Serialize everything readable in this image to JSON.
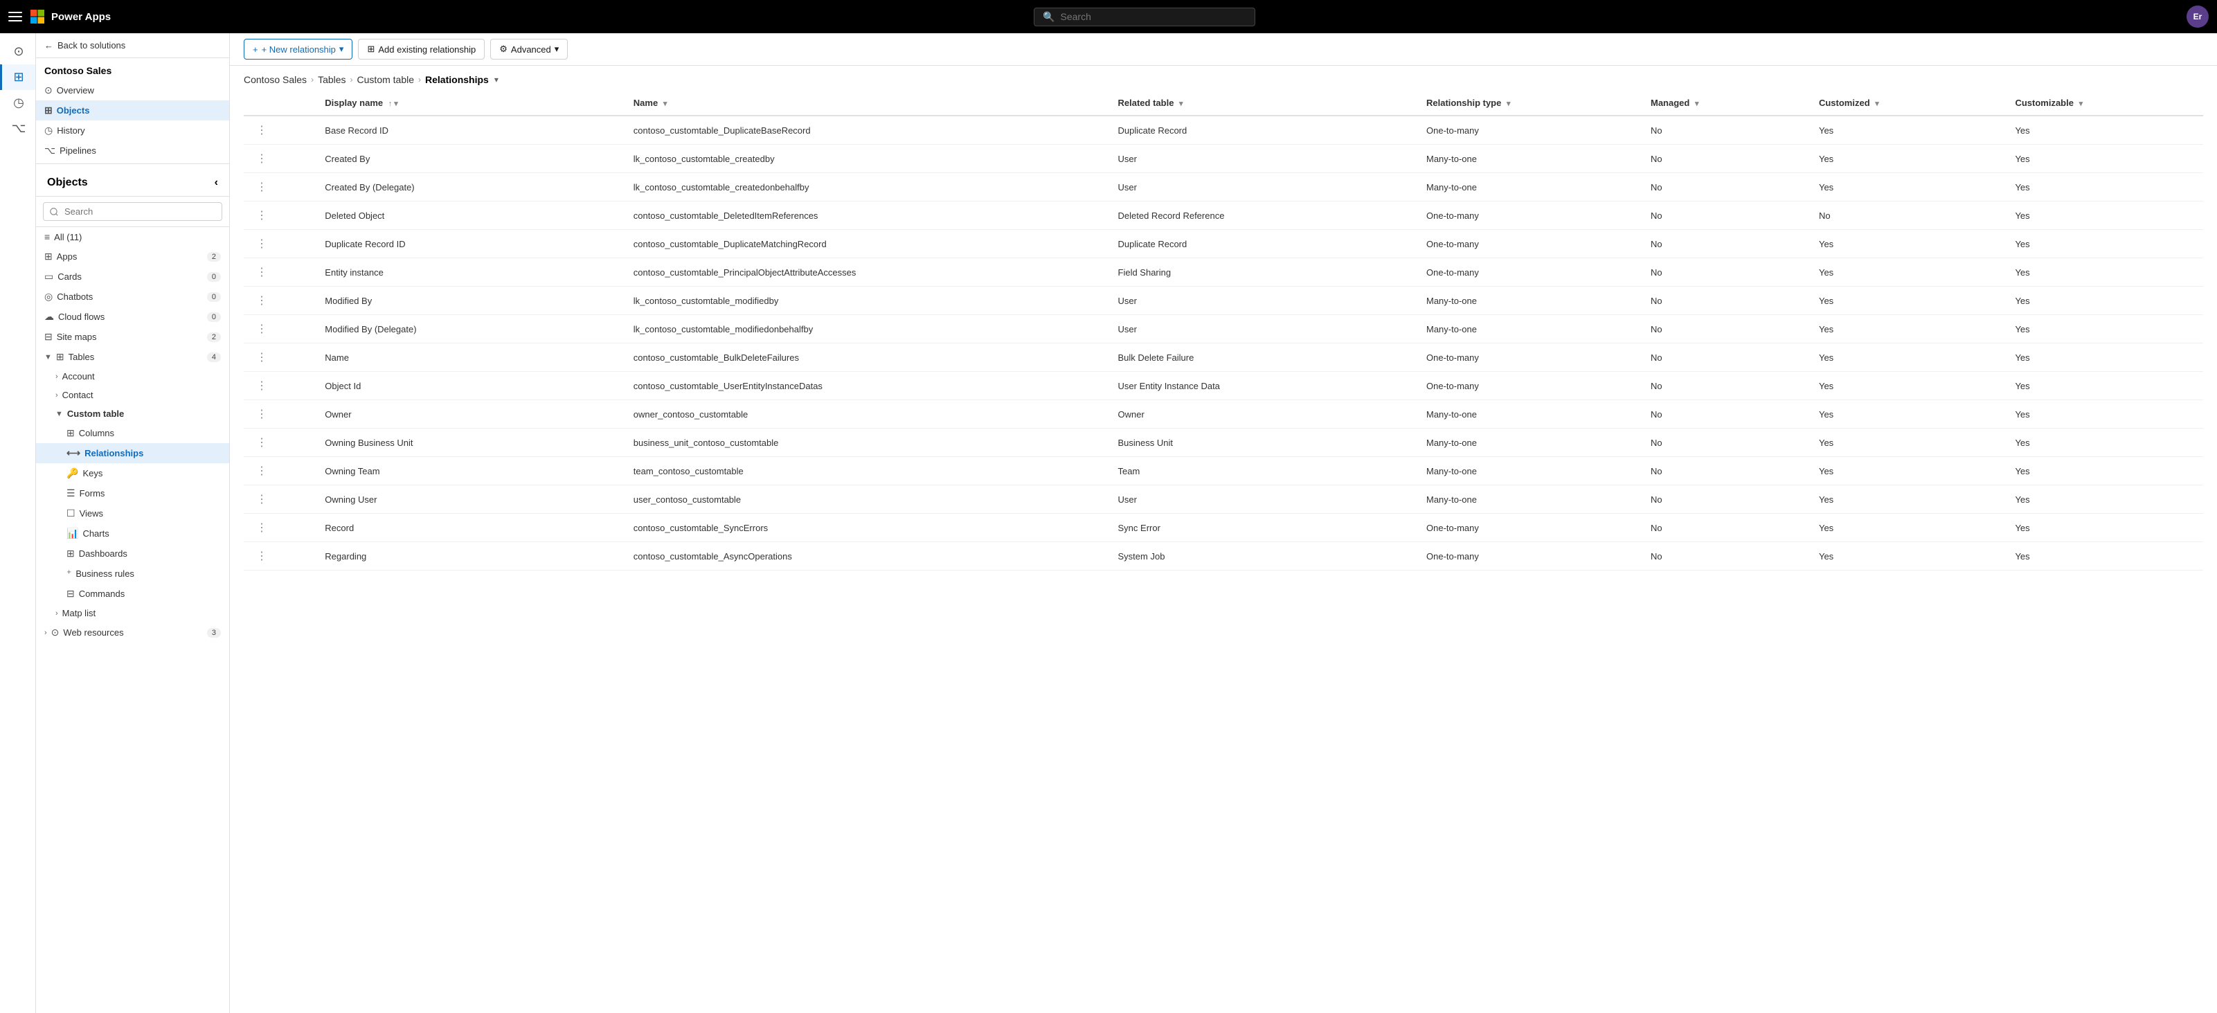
{
  "topbar": {
    "app_name": "Power Apps",
    "search_placeholder": "Search"
  },
  "back_link": "Back to solutions",
  "app_title": "Contoso Sales",
  "objects_header": "Objects",
  "search_placeholder": "Search",
  "left_nav": [
    {
      "id": "overview",
      "icon": "⊙",
      "label": "Overview"
    },
    {
      "id": "objects",
      "icon": "⊞",
      "label": "Objects",
      "active": true
    },
    {
      "id": "history",
      "icon": "◷",
      "label": "History"
    },
    {
      "id": "pipelines",
      "icon": "⌥",
      "label": "Pipelines"
    }
  ],
  "tree": {
    "all_count": 11,
    "items": [
      {
        "id": "all",
        "label": "All (11)",
        "icon": "≡",
        "indent": 0
      },
      {
        "id": "apps",
        "label": "Apps",
        "count": "(2)",
        "icon": "⊞",
        "indent": 0
      },
      {
        "id": "cards",
        "label": "Cards",
        "count": "(0)",
        "icon": "▭",
        "indent": 0
      },
      {
        "id": "chatbots",
        "label": "Chatbots",
        "count": "(0)",
        "icon": "◎",
        "indent": 0
      },
      {
        "id": "cloudflows",
        "label": "Cloud flows",
        "count": "(0)",
        "icon": "☁",
        "indent": 0
      },
      {
        "id": "sitemaps",
        "label": "Site maps",
        "count": "(2)",
        "icon": "⊟",
        "indent": 0
      },
      {
        "id": "tables",
        "label": "Tables",
        "count": "(4)",
        "icon": "⊞",
        "indent": 0,
        "expanded": true
      },
      {
        "id": "account",
        "label": "Account",
        "icon": "",
        "indent": 1
      },
      {
        "id": "contact",
        "label": "Contact",
        "icon": "",
        "indent": 1
      },
      {
        "id": "customtable",
        "label": "Custom table",
        "icon": "",
        "indent": 1,
        "expanded": true
      },
      {
        "id": "columns",
        "label": "Columns",
        "icon": "⊞",
        "indent": 2
      },
      {
        "id": "relationships",
        "label": "Relationships",
        "icon": "⟷",
        "indent": 2,
        "active": true
      },
      {
        "id": "keys",
        "label": "Keys",
        "icon": "⚷",
        "indent": 2
      },
      {
        "id": "forms",
        "label": "Forms",
        "icon": "☰",
        "indent": 2
      },
      {
        "id": "views",
        "label": "Views",
        "icon": "☐",
        "indent": 2
      },
      {
        "id": "charts",
        "label": "Charts",
        "icon": "📈",
        "indent": 2
      },
      {
        "id": "dashboards",
        "label": "Dashboards",
        "icon": "⊞",
        "indent": 2
      },
      {
        "id": "businessrules",
        "label": "Business rules",
        "icon": "⁺",
        "indent": 2
      },
      {
        "id": "commands",
        "label": "Commands",
        "icon": "⊟",
        "indent": 2
      },
      {
        "id": "maplist",
        "label": "Matp list",
        "icon": "",
        "indent": 1
      },
      {
        "id": "webresources",
        "label": "Web resources",
        "count": "(3)",
        "icon": "⊙",
        "indent": 0
      }
    ]
  },
  "toolbar": {
    "new_relationship": "+ New relationship",
    "add_existing": "Add existing relationship",
    "advanced": "Advanced"
  },
  "breadcrumb": {
    "items": [
      "Contoso Sales",
      "Tables",
      "Custom table"
    ],
    "current": "Relationships"
  },
  "table": {
    "columns": [
      {
        "id": "displayname",
        "label": "Display name",
        "sortable": true
      },
      {
        "id": "name",
        "label": "Name",
        "sortable": true
      },
      {
        "id": "related",
        "label": "Related table",
        "sortable": true
      },
      {
        "id": "reltype",
        "label": "Relationship type",
        "sortable": true
      },
      {
        "id": "managed",
        "label": "Managed",
        "sortable": true
      },
      {
        "id": "customized",
        "label": "Customized",
        "sortable": true
      },
      {
        "id": "customizable",
        "label": "Customizable",
        "sortable": true
      }
    ],
    "rows": [
      {
        "displayname": "Base Record ID",
        "name": "contoso_customtable_DuplicateBaseRecord",
        "related": "Duplicate Record",
        "reltype": "One-to-many",
        "managed": "No",
        "customized": "Yes",
        "customizable": "Yes"
      },
      {
        "displayname": "Created By",
        "name": "lk_contoso_customtable_createdby",
        "related": "User",
        "reltype": "Many-to-one",
        "managed": "No",
        "customized": "Yes",
        "customizable": "Yes"
      },
      {
        "displayname": "Created By (Delegate)",
        "name": "lk_contoso_customtable_createdonbehalfby",
        "related": "User",
        "reltype": "Many-to-one",
        "managed": "No",
        "customized": "Yes",
        "customizable": "Yes"
      },
      {
        "displayname": "Deleted Object",
        "name": "contoso_customtable_DeletedItemReferences",
        "related": "Deleted Record Reference",
        "reltype": "One-to-many",
        "managed": "No",
        "customized": "No",
        "customizable": "Yes"
      },
      {
        "displayname": "Duplicate Record ID",
        "name": "contoso_customtable_DuplicateMatchingRecord",
        "related": "Duplicate Record",
        "reltype": "One-to-many",
        "managed": "No",
        "customized": "Yes",
        "customizable": "Yes"
      },
      {
        "displayname": "Entity instance",
        "name": "contoso_customtable_PrincipalObjectAttributeAccesses",
        "related": "Field Sharing",
        "reltype": "One-to-many",
        "managed": "No",
        "customized": "Yes",
        "customizable": "Yes"
      },
      {
        "displayname": "Modified By",
        "name": "lk_contoso_customtable_modifiedby",
        "related": "User",
        "reltype": "Many-to-one",
        "managed": "No",
        "customized": "Yes",
        "customizable": "Yes"
      },
      {
        "displayname": "Modified By (Delegate)",
        "name": "lk_contoso_customtable_modifiedonbehalfby",
        "related": "User",
        "reltype": "Many-to-one",
        "managed": "No",
        "customized": "Yes",
        "customizable": "Yes"
      },
      {
        "displayname": "Name",
        "name": "contoso_customtable_BulkDeleteFailures",
        "related": "Bulk Delete Failure",
        "reltype": "One-to-many",
        "managed": "No",
        "customized": "Yes",
        "customizable": "Yes"
      },
      {
        "displayname": "Object Id",
        "name": "contoso_customtable_UserEntityInstanceDatas",
        "related": "User Entity Instance Data",
        "reltype": "One-to-many",
        "managed": "No",
        "customized": "Yes",
        "customizable": "Yes"
      },
      {
        "displayname": "Owner",
        "name": "owner_contoso_customtable",
        "related": "Owner",
        "reltype": "Many-to-one",
        "managed": "No",
        "customized": "Yes",
        "customizable": "Yes"
      },
      {
        "displayname": "Owning Business Unit",
        "name": "business_unit_contoso_customtable",
        "related": "Business Unit",
        "reltype": "Many-to-one",
        "managed": "No",
        "customized": "Yes",
        "customizable": "Yes"
      },
      {
        "displayname": "Owning Team",
        "name": "team_contoso_customtable",
        "related": "Team",
        "reltype": "Many-to-one",
        "managed": "No",
        "customized": "Yes",
        "customizable": "Yes"
      },
      {
        "displayname": "Owning User",
        "name": "user_contoso_customtable",
        "related": "User",
        "reltype": "Many-to-one",
        "managed": "No",
        "customized": "Yes",
        "customizable": "Yes"
      },
      {
        "displayname": "Record",
        "name": "contoso_customtable_SyncErrors",
        "related": "Sync Error",
        "reltype": "One-to-many",
        "managed": "No",
        "customized": "Yes",
        "customizable": "Yes"
      },
      {
        "displayname": "Regarding",
        "name": "contoso_customtable_AsyncOperations",
        "related": "System Job",
        "reltype": "One-to-many",
        "managed": "No",
        "customized": "Yes",
        "customizable": "Yes"
      }
    ]
  }
}
